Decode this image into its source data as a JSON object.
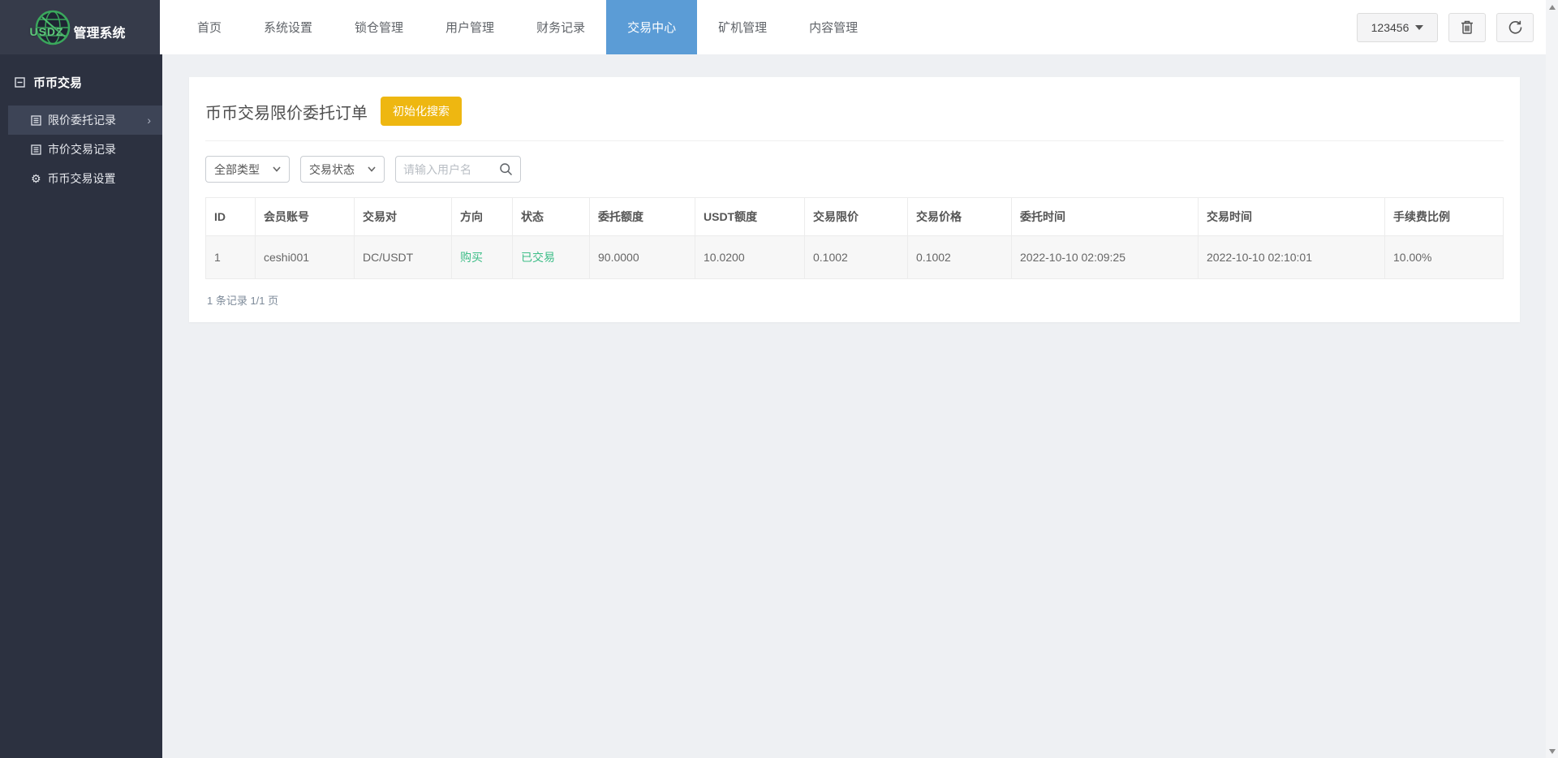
{
  "brand": {
    "logo_text": "USDZ",
    "app_title": "管理系统"
  },
  "navbar": {
    "items": [
      {
        "label": "首页",
        "active": false
      },
      {
        "label": "系统设置",
        "active": false
      },
      {
        "label": "锁仓管理",
        "active": false
      },
      {
        "label": "用户管理",
        "active": false
      },
      {
        "label": "财务记录",
        "active": false
      },
      {
        "label": "交易中心",
        "active": true
      },
      {
        "label": "矿机管理",
        "active": false
      },
      {
        "label": "内容管理",
        "active": false
      }
    ],
    "user_menu": {
      "label": "123456",
      "icon": "caret-down-icon"
    },
    "tools": [
      {
        "icon": "trash-icon"
      },
      {
        "icon": "logout-icon"
      }
    ]
  },
  "sidebar": {
    "group": {
      "label": "币币交易",
      "icon": "collapse-minus-icon"
    },
    "items": [
      {
        "label": "限价委托记录",
        "icon": "list-icon",
        "active": true,
        "chevron": "›"
      },
      {
        "label": "市价交易记录",
        "icon": "list-icon",
        "active": false
      },
      {
        "label": "币币交易设置",
        "icon": "gear-icon",
        "active": false
      }
    ]
  },
  "main": {
    "title": "币币交易限价委托订单",
    "reset_button_label": "初始化搜索",
    "filters": {
      "type_select_value": "全部类型",
      "status_select_value": "交易状态",
      "search_placeholder": "请输入用户名",
      "search_value": ""
    },
    "table": {
      "columns": [
        "ID",
        "会员账号",
        "交易对",
        "方向",
        "状态",
        "委托额度",
        "USDT额度",
        "交易限价",
        "交易价格",
        "委托时间",
        "交易时间",
        "手续费比例"
      ],
      "rows": [
        [
          "1",
          "ceshi001",
          "DC/USDT",
          "购买",
          "已交易",
          "90.0000",
          "10.0200",
          "0.1002",
          "0.1002",
          "2022-10-10 02:09:25",
          "2022-10-10 02:10:01",
          "10.00%"
        ]
      ]
    },
    "pagination": "1 条记录 1/1 页"
  },
  "colors": {
    "nav_active_blue": "#5b9cd6",
    "accent_gold": "#eeb711",
    "success_green": "#3dbd87",
    "sidebar_dark": "#2c3140",
    "logo_block_dark": "#363b4a",
    "page_background": "#eef0f3"
  },
  "gear_glyph": "⚙"
}
